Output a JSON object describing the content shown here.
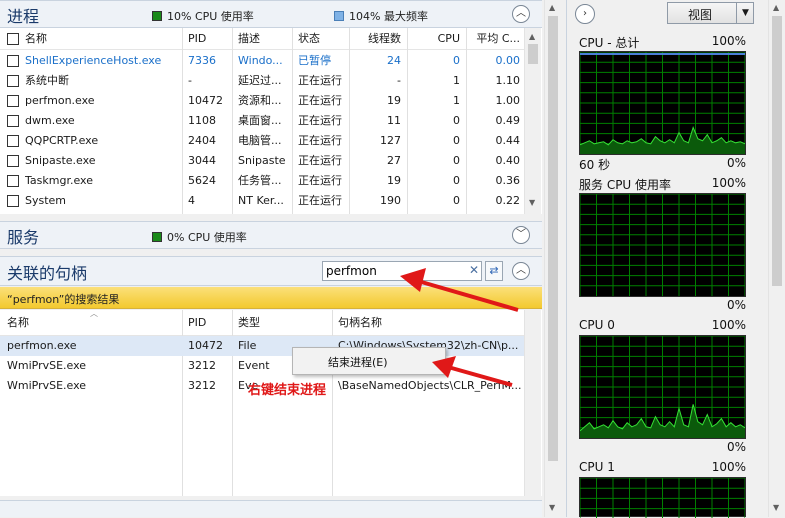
{
  "processes": {
    "title": "进程",
    "cpu_legend": "10% CPU 使用率",
    "freq_legend": "104% 最大频率",
    "columns": [
      "名称",
      "PID",
      "描述",
      "状态",
      "线程数",
      "CPU",
      "平均 C..."
    ],
    "rows": [
      {
        "name": "ShellExperienceHost.exe",
        "pid": "7336",
        "desc": "Windo...",
        "status": "已暂停",
        "threads": "24",
        "cpu": "0",
        "avg": "0.00",
        "highlight": true
      },
      {
        "name": "系统中断",
        "pid": "-",
        "desc": "延迟过...",
        "status": "正在运行",
        "threads": "-",
        "cpu": "1",
        "avg": "1.10",
        "highlight": false
      },
      {
        "name": "perfmon.exe",
        "pid": "10472",
        "desc": "资源和...",
        "status": "正在运行",
        "threads": "19",
        "cpu": "1",
        "avg": "1.00",
        "highlight": false
      },
      {
        "name": "dwm.exe",
        "pid": "1108",
        "desc": "桌面窗...",
        "status": "正在运行",
        "threads": "11",
        "cpu": "0",
        "avg": "0.49",
        "highlight": false
      },
      {
        "name": "QQPCRTP.exe",
        "pid": "2404",
        "desc": "电脑管...",
        "status": "正在运行",
        "threads": "127",
        "cpu": "0",
        "avg": "0.44",
        "highlight": false
      },
      {
        "name": "Snipaste.exe",
        "pid": "3044",
        "desc": "Snipaste",
        "status": "正在运行",
        "threads": "27",
        "cpu": "0",
        "avg": "0.40",
        "highlight": false
      },
      {
        "name": "Taskmgr.exe",
        "pid": "5624",
        "desc": "任务管...",
        "status": "正在运行",
        "threads": "19",
        "cpu": "0",
        "avg": "0.36",
        "highlight": false
      },
      {
        "name": "System",
        "pid": "4",
        "desc": "NT Ker...",
        "status": "正在运行",
        "threads": "190",
        "cpu": "0",
        "avg": "0.22",
        "highlight": false
      }
    ]
  },
  "services": {
    "title": "服务",
    "cpu_legend": "0% CPU 使用率"
  },
  "handles": {
    "title": "关联的句柄",
    "search_value": "perfmon",
    "results_label": "“perfmon”的搜索结果",
    "columns": [
      "名称",
      "PID",
      "类型",
      "句柄名称"
    ],
    "rows": [
      {
        "name": "perfmon.exe",
        "pid": "10472",
        "type": "File",
        "handle": "C:\\Windows\\System32\\zh-CN\\p..."
      },
      {
        "name": "WmiPrvSE.exe",
        "pid": "3212",
        "type": "Event",
        "handle": "CLR_PerfM..."
      },
      {
        "name": "WmiPrvSE.exe",
        "pid": "3212",
        "type": "Eve",
        "handle": "\\BaseNamedObjects\\CLR_PerfM..."
      }
    ],
    "context_menu_item": "结束进程(E)",
    "annotation": "右键结束进程"
  },
  "graphs": {
    "view_label": "视图",
    "cpu_total_title": "CPU - 总计",
    "cpu_total_max": "100%",
    "cpu_total_time": "60 秒",
    "cpu_total_min": "0%",
    "service_title": "服务 CPU 使用率",
    "service_max": "100%",
    "service_min": "0%",
    "cpu0_title": "CPU 0",
    "cpu0_max": "100%",
    "cpu0_min": "0%",
    "cpu1_title": "CPU 1",
    "cpu1_max": "100%"
  },
  "colors": {
    "graph_bg": "#000000",
    "grid": "#008000",
    "line": "#35e035",
    "freq_line": "#4a7fd8",
    "highlight_text": "#1a6fc9",
    "result_bar": "#f8d64a",
    "annotation": "#e01818"
  }
}
